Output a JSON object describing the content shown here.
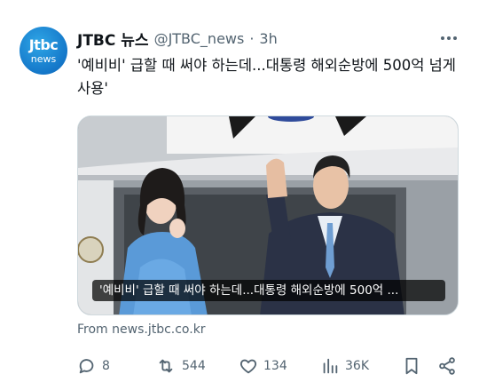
{
  "tweet": {
    "avatar": {
      "line1": "Jtbc",
      "line2": "news"
    },
    "author_name": "JTBC 뉴스",
    "handle": "@JTBC_news",
    "dot": "·",
    "time": "3h",
    "text": "'예비비' 급할 때 써야 하는데...대통령 해외순방에 500억 넘게 사용'",
    "media": {
      "caption": "'예비비' 급할 때 써야 하는데...대통령 해외순방에 500억 ..."
    },
    "source": "From news.jtbc.co.kr",
    "actions": {
      "reply": {
        "icon": "reply-icon",
        "count": "8"
      },
      "retweet": {
        "icon": "retweet-icon",
        "count": "544"
      },
      "like": {
        "icon": "heart-icon",
        "count": "134"
      },
      "views": {
        "icon": "views-icon",
        "count": "36K"
      },
      "bookmark": {
        "icon": "bookmark-icon"
      },
      "share": {
        "icon": "share-icon"
      }
    },
    "colors": {
      "text": "#0f1419",
      "muted": "#536471",
      "border": "#cfd9de",
      "brand": "#1477c9"
    }
  }
}
